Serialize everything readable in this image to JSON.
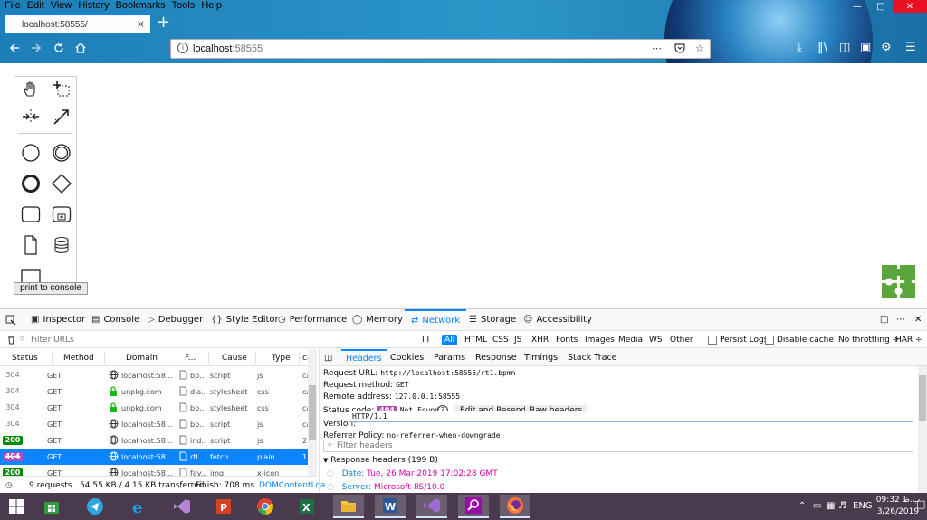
{
  "menu": [
    "File",
    "Edit",
    "View",
    "History",
    "Bookmarks",
    "Tools",
    "Help"
  ],
  "tab": {
    "title": "localhost:58555/",
    "close": "×"
  },
  "newtab": "+",
  "urlbar": {
    "host": "localhost",
    "port": ":58555"
  },
  "page": {
    "print_button": "print to console"
  },
  "devtools": {
    "tabs": [
      {
        "label": "Inspector",
        "icon": "inspector-icon"
      },
      {
        "label": "Console",
        "icon": "console-icon"
      },
      {
        "label": "Debugger",
        "icon": "debugger-icon"
      },
      {
        "label": "Style Editor",
        "icon": "style-editor-icon"
      },
      {
        "label": "Performance",
        "icon": "performance-icon"
      },
      {
        "label": "Memory",
        "icon": "memory-icon"
      },
      {
        "label": "Network",
        "icon": "network-icon"
      },
      {
        "label": "Storage",
        "icon": "storage-icon"
      },
      {
        "label": "Accessibility",
        "icon": "accessibility-icon"
      }
    ],
    "filter_placeholder": "Filter URLs",
    "pause": "I I",
    "types": [
      "All",
      "HTML",
      "CSS",
      "JS",
      "XHR",
      "Fonts",
      "Images",
      "Media",
      "WS",
      "Other"
    ],
    "persist_logs": "Persist Logs",
    "disable_cache": "Disable cache",
    "throttling": "No throttling ÷",
    "har": "HAR ÷",
    "columns": [
      "Status",
      "Method",
      "Domain",
      "F...",
      "Cause",
      "Type",
      "ca"
    ],
    "requests": [
      {
        "status": "304",
        "method": "GET",
        "domain": "localhost:58...",
        "file": "bp...",
        "cause": "script",
        "type": "js",
        "tr": "ca",
        "secure": false
      },
      {
        "status": "304",
        "method": "GET",
        "domain": "unpkg.com",
        "file": "dia...",
        "cause": "stylesheet",
        "type": "css",
        "tr": "ca",
        "secure": true
      },
      {
        "status": "304",
        "method": "GET",
        "domain": "unpkg.com",
        "file": "bp...",
        "cause": "stylesheet",
        "type": "css",
        "tr": "ca",
        "secure": true
      },
      {
        "status": "304",
        "method": "GET",
        "domain": "localhost:58...",
        "file": "bp...",
        "cause": "script",
        "type": "js",
        "tr": "ca",
        "secure": false
      },
      {
        "status": "200",
        "method": "GET",
        "domain": "localhost:58...",
        "file": "ind...",
        "cause": "script",
        "type": "js",
        "tr": "2.",
        "secure": false
      },
      {
        "status": "404",
        "method": "GET",
        "domain": "localhost:58...",
        "file": "rtl...",
        "cause": "fetch",
        "type": "plain",
        "tr": "1",
        "secure": false
      },
      {
        "status": "200",
        "method": "GET",
        "domain": "localhost:58...",
        "file": "fav...",
        "cause": "img",
        "type": "x-icon",
        "tr": "",
        "secure": false
      }
    ],
    "status": {
      "requests": "9 requests",
      "transferred": "54.55 KB / 4.15 KB transferred",
      "finish": "Finish: 708 ms",
      "dcl": "DOMContentLoa"
    },
    "detail_tabs": [
      "Headers",
      "Cookies",
      "Params",
      "Response",
      "Timings",
      "Stack Trace"
    ],
    "headers": {
      "request_url_label": "Request URL:",
      "request_url": "http://localhost:58555/rt1.bpmn",
      "method_label": "Request method:",
      "method": "GET",
      "remote_label": "Remote address:",
      "remote": "127.0.0.1:58555",
      "status_label": "Status code:",
      "status_badge": "404",
      "status_text": "Not Found",
      "help": "?",
      "edit_resend": "Edit and Resend",
      "raw_headers": "Raw headers",
      "version_label": "Version:",
      "version": "HTTP/1.1",
      "referrer_label": "Referrer Policy:",
      "referrer": "no-referrer-when-downgrade",
      "filter_headers": "Filter headers",
      "response_section": "Response headers (199 B)",
      "date_label": "Date:",
      "date": "Tue, 26 Mar 2019 17:02:28 GMT",
      "server_label": "Server:",
      "server": "Microsoft-IIS/10.0"
    }
  },
  "taskbar": {
    "lang": "ENG",
    "time": "09:32 ب.ظ",
    "date": "3/26/2019"
  },
  "colors": {
    "accent": "#0a84ff",
    "status_ok": "#058b00",
    "status_404": "#b64ab6",
    "taskbar": "#4a3a4d"
  }
}
